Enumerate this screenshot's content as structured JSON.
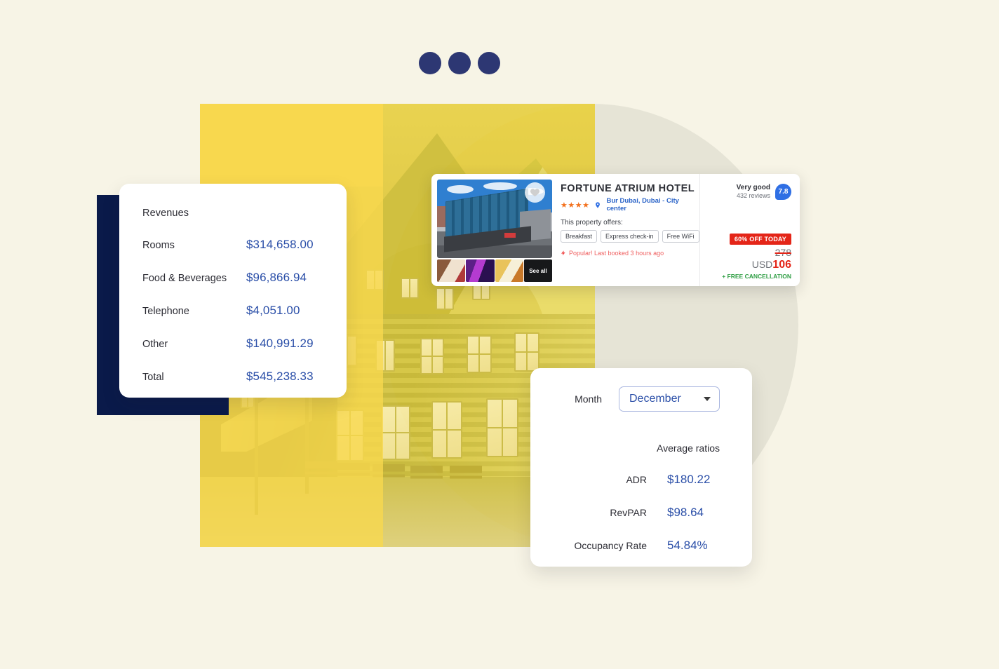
{
  "page": {
    "background_color": "#f7f4e6",
    "accent_navy": "#2d3773",
    "accent_yellow": "#f8d84e",
    "accent_blue": "#2b4fa8",
    "dark_navy": "#0a1a4a"
  },
  "dots": [
    {
      "name": "dot-1"
    },
    {
      "name": "dot-2"
    },
    {
      "name": "dot-3"
    }
  ],
  "revenues_card": {
    "title": "Revenues",
    "rows": [
      {
        "label": "Rooms",
        "value": "$314,658.00"
      },
      {
        "label": "Food & Beverages",
        "value": "$96,866.94"
      },
      {
        "label": "Telephone",
        "value": "$4,051.00"
      },
      {
        "label": "Other",
        "value": "$140,991.29"
      },
      {
        "label": "Total",
        "value": "$545,238.33"
      }
    ]
  },
  "hotel_card": {
    "name": "FORTUNE ATRIUM HOTEL",
    "stars": "★★★★",
    "location": "Bur Dubai, Dubai - City center",
    "offers_label": "This property offers:",
    "amenities": [
      "Breakfast",
      "Express check-in",
      "Free WiFi"
    ],
    "popular_text": "Popular! Last booked 3 hours ago",
    "see_all": "See all",
    "rating": {
      "label": "Very good",
      "reviews": "432 reviews",
      "score": "7.8",
      "score_color": "#2f6fe4"
    },
    "deal": {
      "badge": "60% OFF TODAY",
      "badge_color": "#e42518",
      "old_price": "278",
      "currency": "USD",
      "price": "106",
      "cancellation": "+ FREE CANCELLATION"
    }
  },
  "ratios_card": {
    "month_label": "Month",
    "month_value": "December",
    "average_title": "Average ratios",
    "rows": [
      {
        "label": "ADR",
        "value": "$180.22"
      },
      {
        "label": "RevPAR",
        "value": "$98.64"
      },
      {
        "label": "Occupancy Rate",
        "value": "54.84%"
      }
    ]
  }
}
